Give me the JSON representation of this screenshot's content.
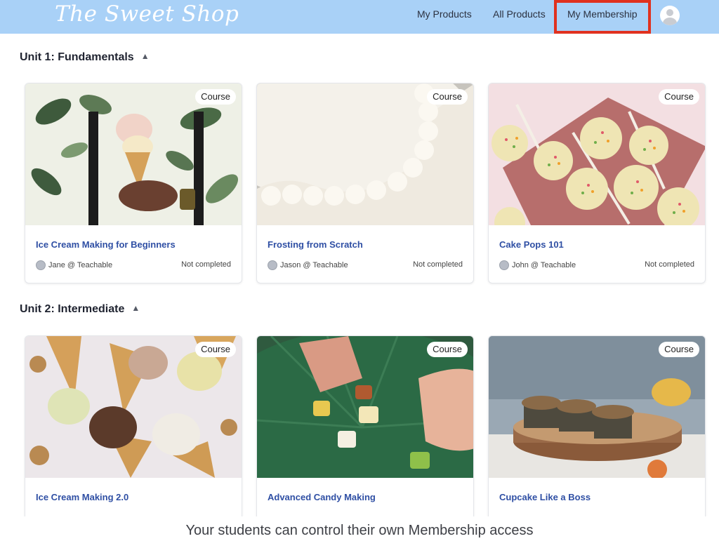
{
  "header": {
    "logo": "The Sweet Shop",
    "nav": [
      "My Products",
      "All Products",
      "My Membership"
    ]
  },
  "units": [
    {
      "title": "Unit 1: Fundamentals",
      "cards": [
        {
          "badge": "Course",
          "title": "Ice Cream Making for Beginners",
          "author": "Jane @ Teachable",
          "status": "Not completed"
        },
        {
          "badge": "Course",
          "title": "Frosting from Scratch",
          "author": "Jason @ Teachable",
          "status": "Not completed"
        },
        {
          "badge": "Course",
          "title": "Cake Pops 101",
          "author": "John @ Teachable",
          "status": "Not completed"
        }
      ]
    },
    {
      "title": "Unit 2: Intermediate",
      "cards": [
        {
          "badge": "Course",
          "title": "Ice Cream Making 2.0"
        },
        {
          "badge": "Course",
          "title": "Advanced Candy Making"
        },
        {
          "badge": "Course",
          "title": "Cupcake Like a Boss"
        }
      ]
    }
  ],
  "caption": "Your students can control their own Membership access",
  "colors": {
    "header_bg": "#a9d1f7",
    "highlight": "#e0311f",
    "title_link": "#2f4fa4"
  }
}
